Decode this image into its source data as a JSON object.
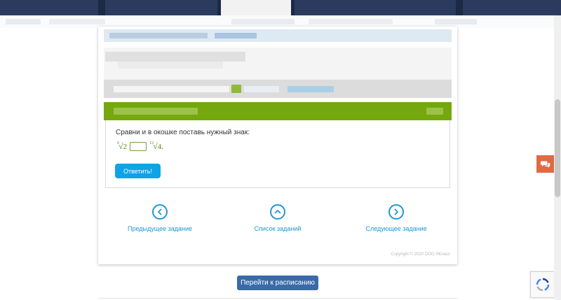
{
  "exercise": {
    "question": "Сравни и в окошке поставь нужный знак:",
    "left_index": "6",
    "left_radicand": "2",
    "right_index": "12",
    "right_radicand": "4",
    "end": "."
  },
  "buttons": {
    "answer": "Ответить!",
    "schedule": "Перейти к расписанию"
  },
  "navigation": {
    "prev": "Предыдущее задание",
    "list": "Список заданий",
    "next": "Следующее задание"
  },
  "footer": {
    "copyright": "Copyright © 2020 ООО ЯКласс"
  },
  "colors": {
    "accent": "#2196d3",
    "green": "#74a80e",
    "answer_button": "#0da3e6",
    "schedule_button": "#3a6aa8",
    "chat": "#e06a41"
  },
  "icons": {
    "prev": "chevron-left-icon",
    "list": "chevron-up-icon",
    "next": "chevron-right-icon",
    "chat": "chat-icon",
    "captcha": "recaptcha-icon"
  }
}
